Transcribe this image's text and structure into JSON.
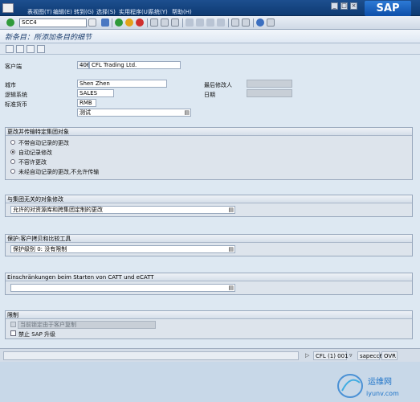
{
  "menubar": {
    "items": [
      "表视图(T)",
      "编辑(E)",
      "转到(G)",
      "选择(S)",
      "实用程序(U)",
      "系统(Y)",
      "帮助(H)"
    ],
    "logo": "SAP"
  },
  "toolbar": {
    "command_field": "SCC4"
  },
  "screen": {
    "title": "新条目：所添加条目的细节"
  },
  "form": {
    "client_label": "客户端",
    "client_number": "406",
    "client_name": "CFL Trading Ltd.",
    "city_label": "城市",
    "city_value": "Shen Zhen",
    "logical_system_label": "逻辑系统",
    "logical_system_value": "SALES",
    "currency_label": "标准货币",
    "currency_value": "RMB",
    "role_value": "测试",
    "last_changed_by_label": "最后修改人",
    "date_label": "日期"
  },
  "group_changes": {
    "title": "更改并传输特定集团对象",
    "options": [
      {
        "label": "不带自动记录的更改",
        "selected": false
      },
      {
        "label": "自动记录修改",
        "selected": true
      },
      {
        "label": "不容许更改",
        "selected": false
      },
      {
        "label": "未经自动记录的更改,不允许传输",
        "selected": false
      }
    ]
  },
  "group_cross_client": {
    "title": "与集团无关的对象修改",
    "value": "允许的对资源库和跨集团定制的更改"
  },
  "group_protection": {
    "title": "保护:客户拷贝和比较工具",
    "value": "保护级别 0: 没有限制"
  },
  "group_catt": {
    "title": "Einschränkungen beim Starten von CATT und eCATT",
    "value": ""
  },
  "group_restrictions": {
    "title": "限制",
    "items": [
      {
        "label": "当前锁定由于客户复制",
        "enabled": false,
        "checked": false
      },
      {
        "label": "禁止 SAP 升级",
        "enabled": true,
        "checked": false
      }
    ]
  },
  "statusbar": {
    "system": "CFL (1) 001",
    "server": "sapecc6",
    "mode": "OVR"
  },
  "watermark": {
    "text": "运维网",
    "url": "iyunv.com"
  },
  "colors": {
    "menubar": "#0e3a72",
    "workarea": "#dde8f2"
  }
}
